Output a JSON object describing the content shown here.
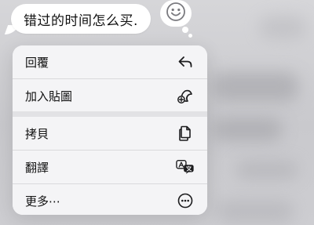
{
  "message": {
    "text": "错过的时间怎么买."
  },
  "reaction": {
    "icon": "smiley-face-icon"
  },
  "menu": {
    "items": [
      {
        "label": "回覆",
        "icon": "reply-arrow-icon"
      },
      {
        "label": "加入貼圖",
        "icon": "add-sticker-icon"
      },
      {
        "label": "拷貝",
        "icon": "copy-icon"
      },
      {
        "label": "翻譯",
        "icon": "translate-icon"
      },
      {
        "label": "更多⋯",
        "icon": "more-ellipsis-icon"
      }
    ]
  },
  "colors": {
    "menu_background": "#f4f4f6",
    "bubble_background": "#ffffff",
    "text": "#111111",
    "icon": "#1c1c1e"
  }
}
